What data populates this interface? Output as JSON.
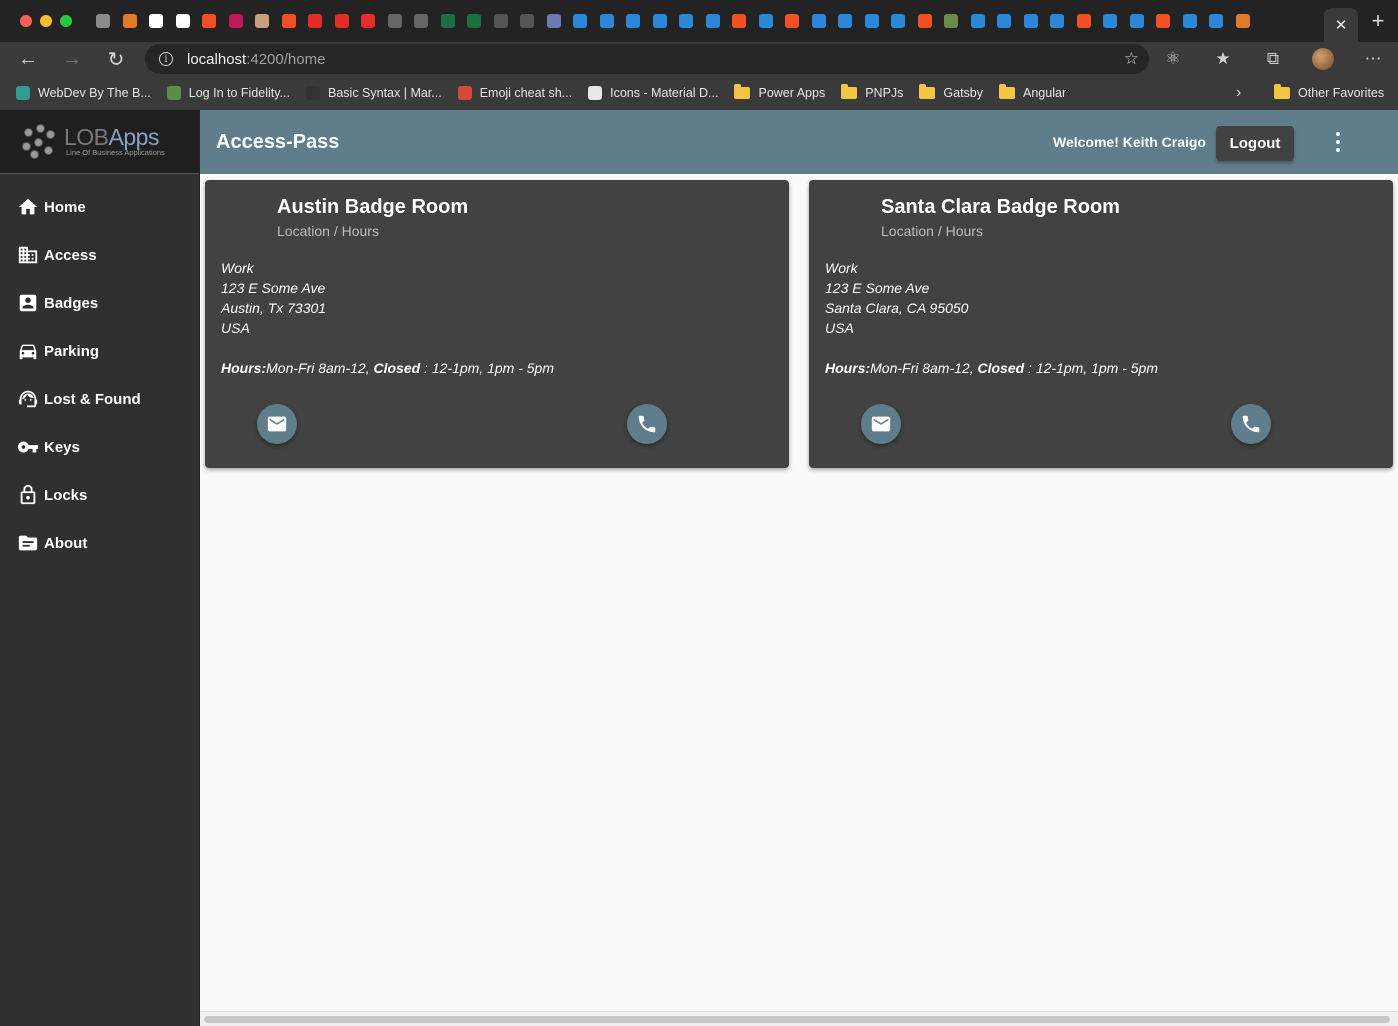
{
  "browser": {
    "url_host": "localhost",
    "url_path": ":4200/home",
    "bookmarks": [
      {
        "label": "WebDev By The B...",
        "color": "#2e9c8e"
      },
      {
        "label": "Log In to Fidelity...",
        "color": "#5a8f4a"
      },
      {
        "label": "Basic Syntax | Mar...",
        "color": "#333333"
      },
      {
        "label": "Emoji cheat sh...",
        "color": "#d24b3a"
      },
      {
        "label": "Icons - Material D...",
        "color": "#e8e8e8"
      }
    ],
    "bookmark_folders": [
      "Power Apps",
      "PNPJs",
      "Gatsby",
      "Angular"
    ],
    "other_favorites": "Other Favorites",
    "tab_icon_colors": [
      "#8a8a8a",
      "#e07b2a",
      "#ffffff",
      "#ffffff",
      "#f25022",
      "#c2185b",
      "#c9a07a",
      "#f25022",
      "#e52d27",
      "#e52d27",
      "#e52d27",
      "#666666",
      "#666666",
      "#1d6f42",
      "#1d6f42",
      "#555555",
      "#555555",
      "#6b7ab0",
      "#2b88d8",
      "#2b88d8",
      "#2b88d8",
      "#2b88d8",
      "#2b88d8",
      "#2b88d8",
      "#f25022",
      "#2b88d8",
      "#f25022",
      "#2b88d8",
      "#2b88d8",
      "#2b88d8",
      "#2b88d8",
      "#f25022",
      "#6a8c4a",
      "#2b88d8",
      "#2b88d8",
      "#2b88d8",
      "#2b88d8",
      "#f25022",
      "#2b88d8",
      "#2b88d8",
      "#f25022",
      "#2b88d8",
      "#2b88d8",
      "#e07b2a"
    ]
  },
  "app": {
    "logo_primary": "LOB",
    "logo_secondary": "Apps",
    "logo_tagline": "Line Of Business Applications",
    "title": "Access-Pass",
    "welcome": "Welcome! Keith Craigo",
    "logout_label": "Logout"
  },
  "nav": [
    {
      "label": "Home",
      "icon": "home-icon"
    },
    {
      "label": "Access",
      "icon": "building-icon"
    },
    {
      "label": "Badges",
      "icon": "badge-icon"
    },
    {
      "label": "Parking",
      "icon": "car-icon"
    },
    {
      "label": "Lost & Found",
      "icon": "support-agent-icon"
    },
    {
      "label": "Keys",
      "icon": "key-icon"
    },
    {
      "label": "Locks",
      "icon": "lock-icon"
    },
    {
      "label": "About",
      "icon": "info-card-icon"
    }
  ],
  "cards": [
    {
      "title": "Austin Badge Room",
      "subtitle": "Location / Hours",
      "address_label": "Work",
      "street": "123 E Some Ave",
      "city": "Austin, Tx 73301",
      "country": "USA",
      "hours_label": "Hours:",
      "hours_open": "Mon-Fri 8am-12, ",
      "closed_label": "Closed",
      "hours_rest": " : 12-1pm, 1pm - 5pm"
    },
    {
      "title": "Santa Clara Badge Room",
      "subtitle": "Location / Hours",
      "address_label": "Work",
      "street": "123 E Some Ave",
      "city": "Santa Clara, CA 95050",
      "country": "USA",
      "hours_label": "Hours:",
      "hours_open": "Mon-Fri 8am-12, ",
      "closed_label": "Closed",
      "hours_rest": " : 12-1pm, 1pm - 5pm"
    }
  ],
  "colors": {
    "toolbar": "#607d8b",
    "sidebar": "#303030",
    "card": "#424242",
    "fab": "#607d8b"
  }
}
